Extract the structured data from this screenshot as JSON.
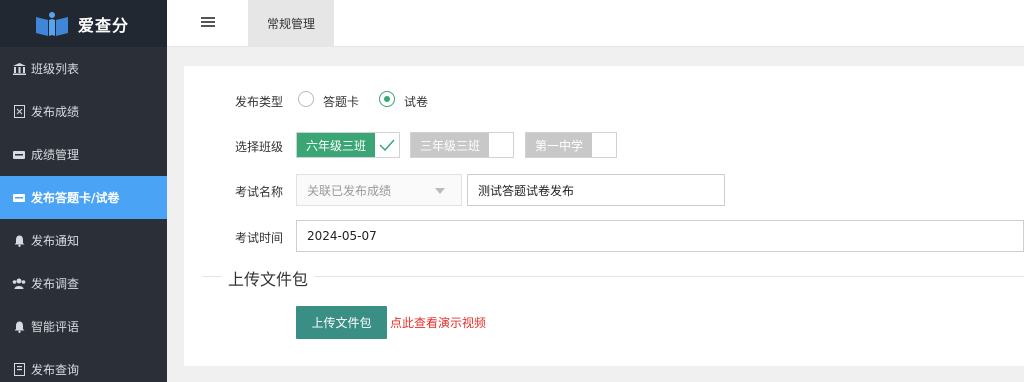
{
  "app": {
    "title": "爱查分"
  },
  "sidebar": {
    "items": [
      {
        "label": "班级列表",
        "icon": "bank-icon"
      },
      {
        "label": "发布成绩",
        "icon": "doc-icon"
      },
      {
        "label": "成绩管理",
        "icon": "card-icon"
      },
      {
        "label": "发布答题卡/试卷",
        "icon": "card-icon",
        "active": true
      },
      {
        "label": "发布通知",
        "icon": "bell-icon"
      },
      {
        "label": "发布调查",
        "icon": "users-icon"
      },
      {
        "label": "智能评语",
        "icon": "bell-icon"
      },
      {
        "label": "发布查询",
        "icon": "doc-icon"
      }
    ]
  },
  "topbar": {
    "tab_label": "常规管理"
  },
  "form": {
    "type_label": "发布类型",
    "type_options": [
      {
        "label": "答题卡",
        "checked": false
      },
      {
        "label": "试卷",
        "checked": true
      }
    ],
    "class_label": "选择班级",
    "classes": [
      {
        "label": "六年级三班",
        "on": true
      },
      {
        "label": "三年级三班",
        "on": false
      },
      {
        "label": "第一中学",
        "on": false
      }
    ],
    "exam_name_label": "考试名称",
    "exam_select_placeholder": "关联已发布成绩",
    "exam_name_value": "测试答题试卷发布",
    "exam_time_label": "考试时间",
    "exam_time_value": "2024-05-07"
  },
  "upload": {
    "section_title": "上传文件包",
    "button_label": "上传文件包",
    "demo_link": "点此查看演示视频"
  },
  "colors": {
    "sidebar_bg": "#2b3038",
    "active_nav": "#4aa3f5",
    "accent_green": "#3aa575",
    "upload_button": "#3a8f85",
    "link_red": "#e0322b"
  }
}
